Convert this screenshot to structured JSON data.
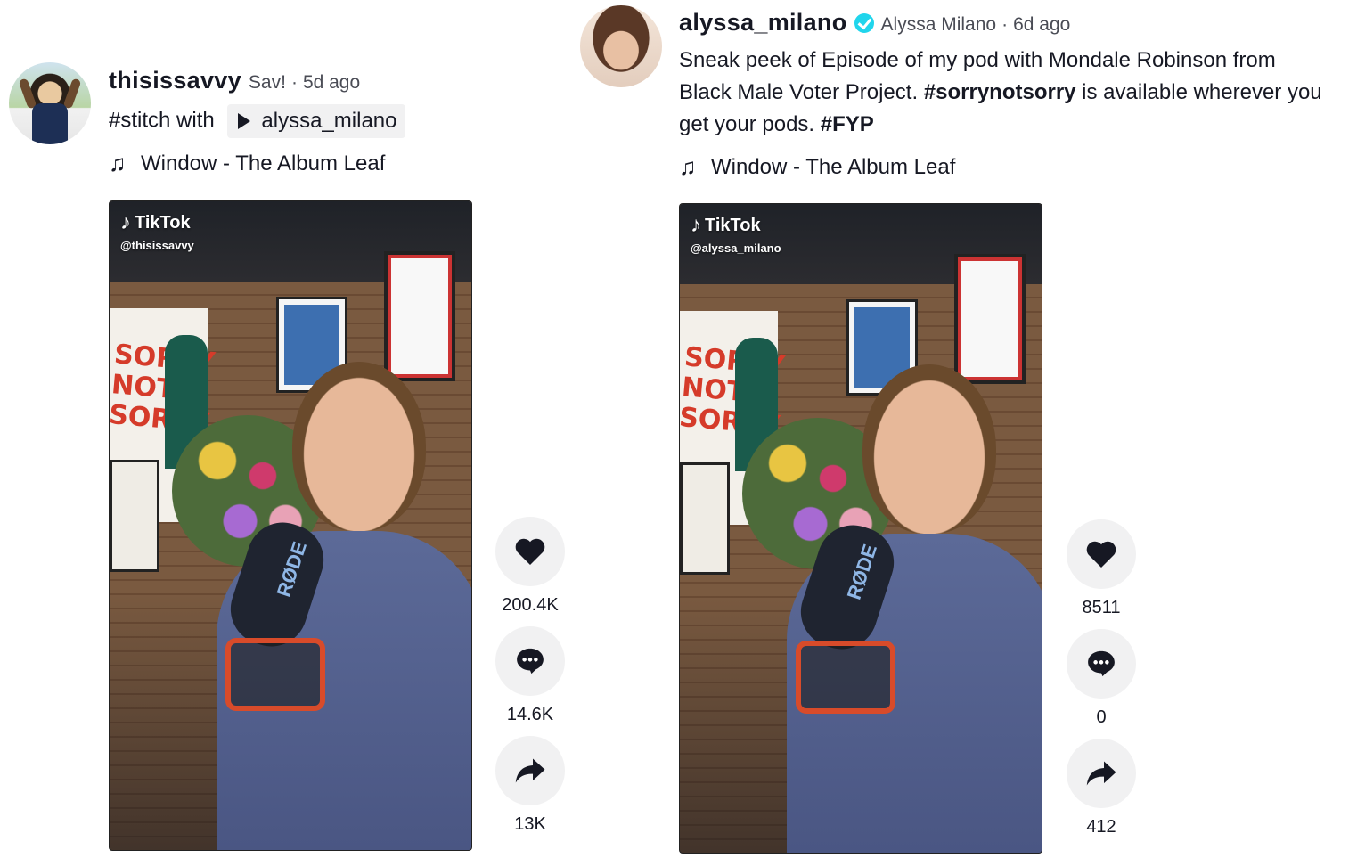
{
  "left_post": {
    "username": "thisissavvy",
    "display_name": "Sav!",
    "time_ago": "5d ago",
    "stitch_tag": "#stitch",
    "stitch_with": "with",
    "stitch_target": "alyssa_milano",
    "music": "Window - The Album Leaf",
    "video": {
      "brand": "TikTok",
      "handle": "@thisissavvy",
      "poster_text": "SORRY NOT SORRY",
      "mic_label": "RØDE"
    },
    "likes": "200.4K",
    "comments": "14.6K",
    "shares": "13K"
  },
  "right_post": {
    "username": "alyssa_milano",
    "display_name": "Alyssa Milano",
    "time_ago": "6d ago",
    "caption_line1": "Sneak peek of Episode of my pod with Mondale Robinson from",
    "caption_line2_pre": "Black Male Voter Project. ",
    "caption_tag1": "#sorrynotsorry",
    "caption_line2_post": " is available wherever you",
    "caption_line3_pre": "get your pods. ",
    "caption_tag2": "#FYP",
    "music": "Window - The Album Leaf",
    "video": {
      "brand": "TikTok",
      "handle": "@alyssa_milano",
      "poster_text": "SORRY NOT SORRY",
      "mic_label": "RØDE"
    },
    "likes": "8511",
    "comments": "0",
    "shares": "412"
  },
  "icons": {
    "music": "music-note-icon",
    "like": "heart-icon",
    "comment": "comment-icon",
    "share": "share-icon",
    "verified": "verified-badge-icon",
    "play": "play-icon"
  },
  "colors": {
    "verified": "#20d5ec",
    "text": "#161823",
    "button_bg": "#f1f1f2"
  }
}
